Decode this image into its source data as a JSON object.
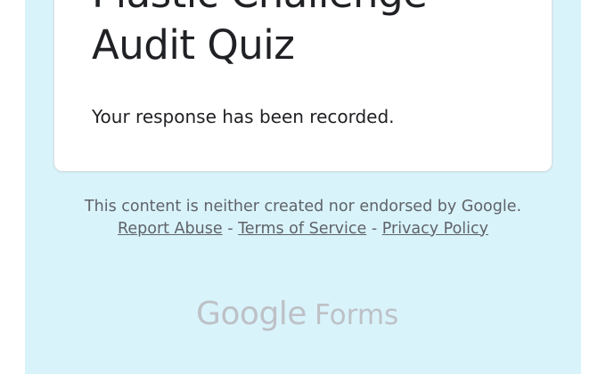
{
  "form": {
    "title_line1": "Plastic Challenge",
    "title_line2": "Audit Quiz",
    "confirmation": "Your response has been recorded."
  },
  "footer": {
    "disclaimer": "This content is neither created nor endorsed by Google.",
    "report_abuse": "Report Abuse",
    "separator1": " - ",
    "terms": "Terms of Service",
    "separator2": " - ",
    "privacy": "Privacy Policy"
  },
  "branding": {
    "google": "Google",
    "forms": "Forms"
  }
}
